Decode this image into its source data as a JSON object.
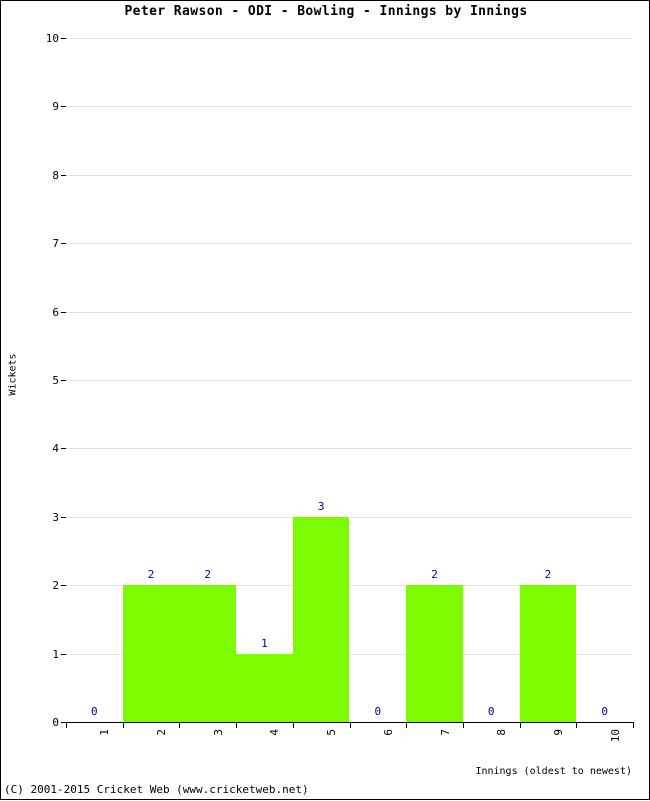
{
  "title": "Peter Rawson - ODI - Bowling - Innings by Innings",
  "footer": {
    "copyright": "(C) 2001-2015 Cricket Web (www.cricketweb.net)"
  },
  "colors": {
    "bar": "#7dfc00",
    "value_label": "#00008b",
    "gridline": "#e3e3e3",
    "axis": "#000000",
    "background": "#ffffff"
  },
  "chart_data": {
    "type": "bar",
    "title": "Peter Rawson - ODI - Bowling - Innings by Innings",
    "xlabel": "Innings (oldest to newest)",
    "ylabel": "Wickets",
    "categories": [
      "1",
      "2",
      "3",
      "4",
      "5",
      "6",
      "7",
      "8",
      "9",
      "10"
    ],
    "values": [
      0,
      2,
      2,
      1,
      3,
      0,
      2,
      0,
      2,
      0
    ],
    "data_labels": [
      "0",
      "2",
      "2",
      "1",
      "3",
      "0",
      "2",
      "0",
      "2",
      "0"
    ],
    "ylim": [
      0,
      10
    ],
    "y_ticks": [
      "0",
      "1",
      "2",
      "3",
      "4",
      "5",
      "6",
      "7",
      "8",
      "9",
      "10"
    ],
    "x_tick_labels": [
      "1",
      "2",
      "3",
      "4",
      "5",
      "6",
      "7",
      "8",
      "9",
      "10"
    ],
    "grid": true,
    "grid_axis": "y",
    "legend": false,
    "series": [
      {
        "name": "Wickets",
        "values": [
          0,
          2,
          2,
          1,
          3,
          0,
          2,
          0,
          2,
          0
        ]
      }
    ]
  }
}
